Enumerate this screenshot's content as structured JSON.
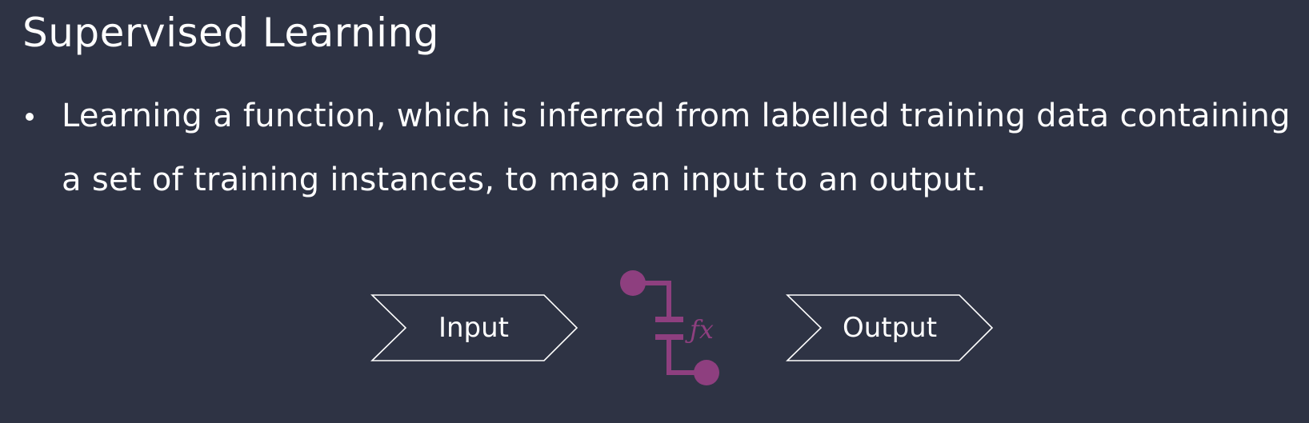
{
  "slide": {
    "title": "Supervised Learning",
    "bullets": [
      "Learning a function, which is inferred from labelled training data containing a set of training instances, to map an input to an output."
    ]
  },
  "diagram": {
    "input_label": "Input",
    "function_label": "ƒx",
    "output_label": "Output",
    "accent_color": "#8e3f7f",
    "outline_color": "#ffffff",
    "background_color": "#2e3344"
  }
}
